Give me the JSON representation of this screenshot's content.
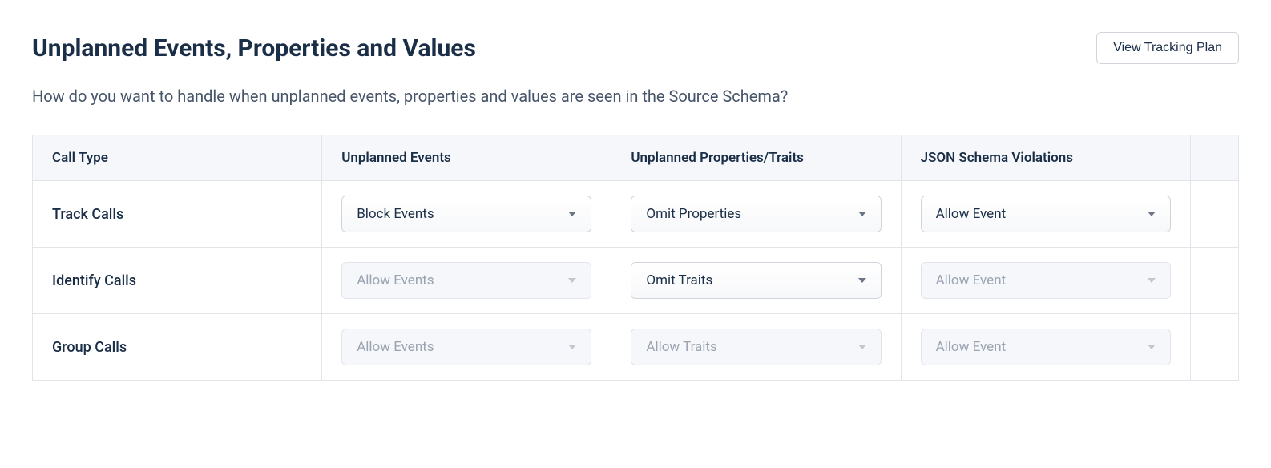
{
  "header": {
    "title": "Unplanned Events, Properties and Values",
    "view_plan_label": "View Tracking Plan"
  },
  "description": "How do you want to handle when unplanned events, properties and values are seen in the Source Schema?",
  "table": {
    "columns": {
      "call_type": "Call Type",
      "unplanned_events": "Unplanned Events",
      "unplanned_props": "Unplanned Properties/Traits",
      "json_violations": "JSON Schema Violations"
    },
    "rows": [
      {
        "label": "Track Calls",
        "events": {
          "value": "Block Events",
          "enabled": true
        },
        "props": {
          "value": "Omit Properties",
          "enabled": true
        },
        "json": {
          "value": "Allow Event",
          "enabled": true
        }
      },
      {
        "label": "Identify Calls",
        "events": {
          "value": "Allow Events",
          "enabled": false
        },
        "props": {
          "value": "Omit Traits",
          "enabled": true
        },
        "json": {
          "value": "Allow Event",
          "enabled": false
        }
      },
      {
        "label": "Group Calls",
        "events": {
          "value": "Allow Events",
          "enabled": false
        },
        "props": {
          "value": "Allow Traits",
          "enabled": false
        },
        "json": {
          "value": "Allow Event",
          "enabled": false
        }
      }
    ]
  }
}
